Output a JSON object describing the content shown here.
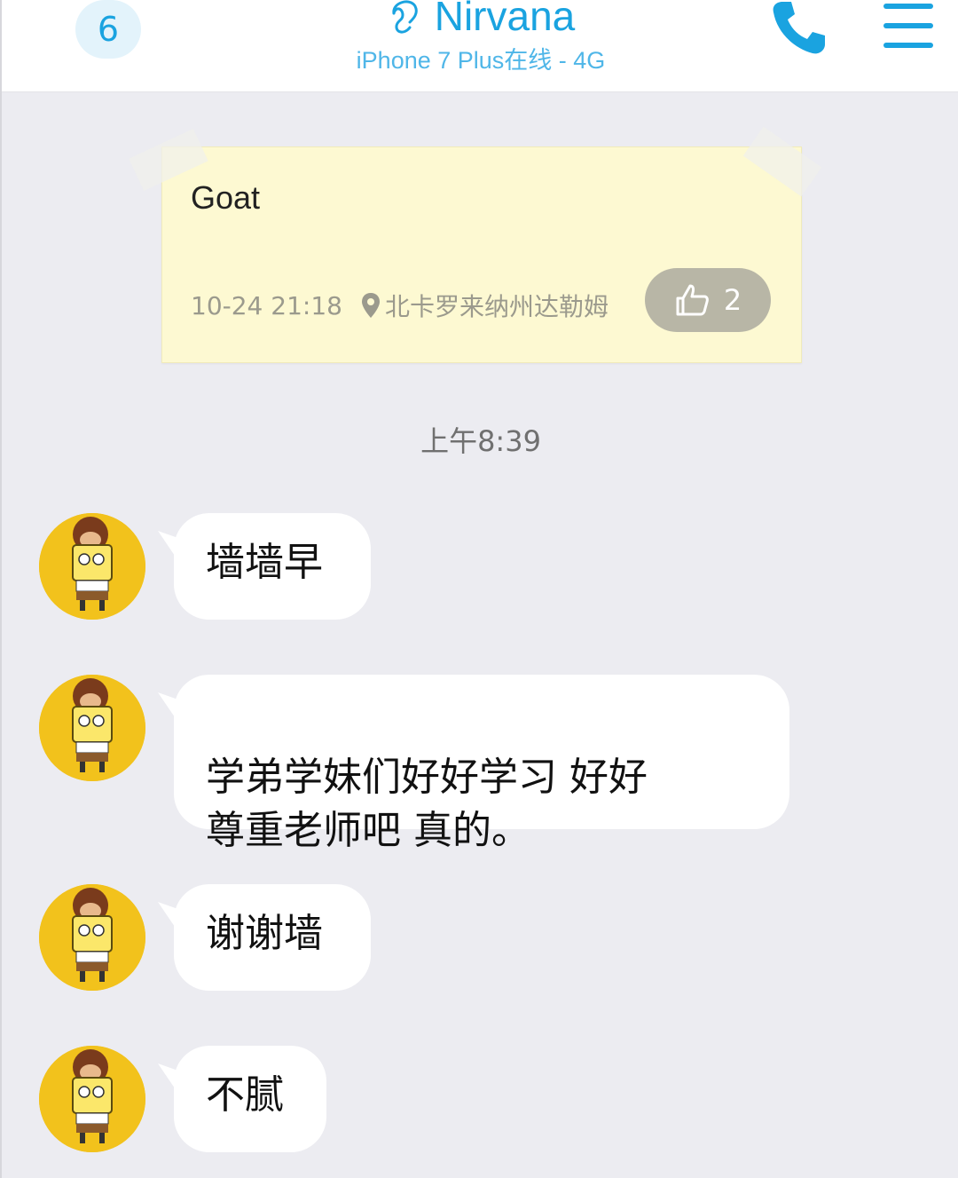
{
  "header": {
    "unread_count": "6",
    "title": "Nirvana",
    "subtitle": "iPhone 7 Plus在线 - 4G",
    "icons": [
      "ear-icon",
      "phone-icon",
      "menu-icon"
    ],
    "accent_color": "#1aa3e0"
  },
  "note": {
    "text": "Goat",
    "date": "10-24 21:18",
    "location": "北卡罗来纳州达勒姆",
    "likes": "2"
  },
  "divider_time": "上午8:39",
  "messages": [
    {
      "text": "墙墙早"
    },
    {
      "text": "学弟学妹们好好学习 好好\n尊重老师吧 真的。"
    },
    {
      "text": "谢谢墙"
    },
    {
      "text": "不腻"
    }
  ]
}
